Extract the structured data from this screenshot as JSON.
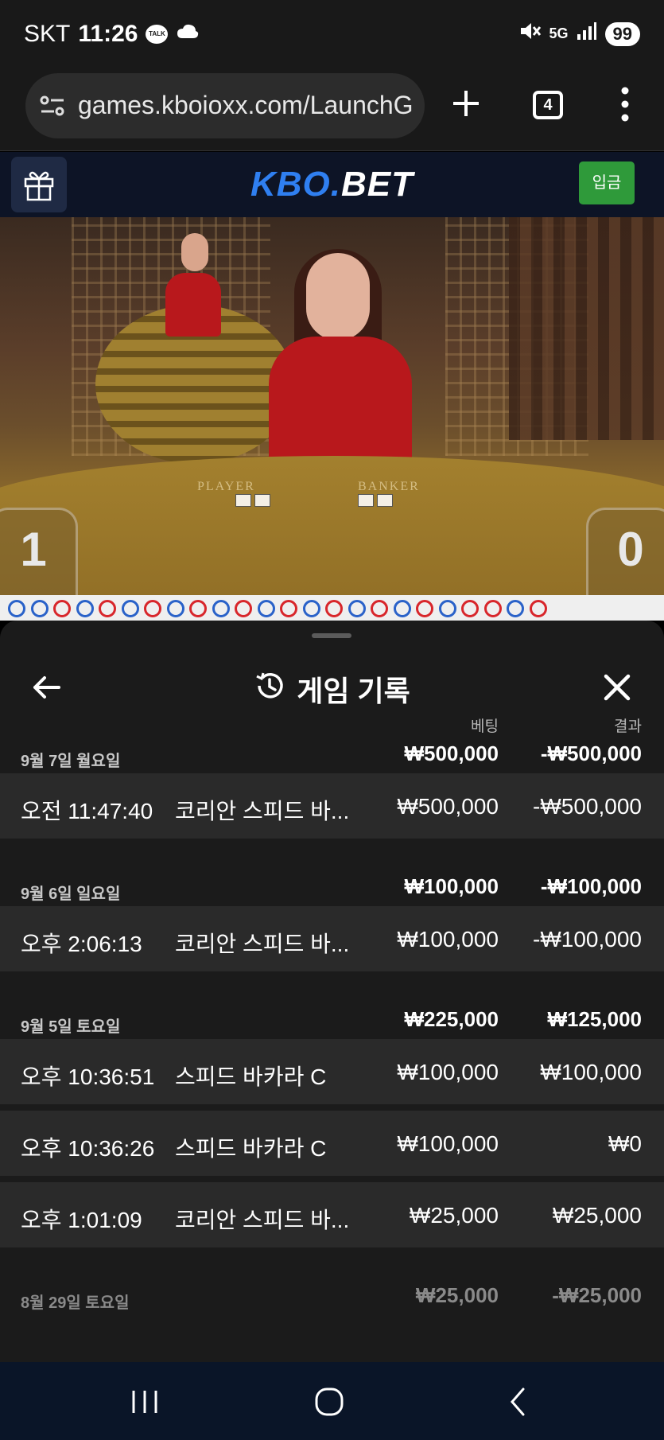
{
  "status_bar": {
    "carrier": "SKT",
    "time": "11:26",
    "notification_icons": [
      "talk-icon",
      "cloud-icon"
    ],
    "talk_label": "TALK",
    "network": "5G",
    "battery": "99"
  },
  "browser": {
    "url": "games.kboioxx.com/LaunchGame",
    "tab_count": "4"
  },
  "site_header": {
    "logo_part1": "KBO.",
    "logo_part2": "BET",
    "deposit_label": "입금",
    "colors": {
      "logo_blue": "#2f7ff0",
      "deposit_green": "#2f9a3a",
      "header_bg": "#0d1426"
    }
  },
  "video": {
    "player_label": "PLAYER",
    "banker_label": "BANKER",
    "player_score": "1",
    "banker_score": "0"
  },
  "sheet": {
    "title": "게임 기록",
    "col_bet": "베팅",
    "col_result": "결과",
    "groups": [
      {
        "date": "9월 7일 월요일",
        "bet_total": "₩500,000",
        "result_total": "-₩500,000",
        "rows": [
          {
            "time": "오전 11:47:40",
            "game": "코리안 스피드 바...",
            "bet": "₩500,000",
            "result": "-₩500,000"
          }
        ]
      },
      {
        "date": "9월 6일 일요일",
        "bet_total": "₩100,000",
        "result_total": "-₩100,000",
        "rows": [
          {
            "time": "오후 2:06:13",
            "game": "코리안 스피드 바...",
            "bet": "₩100,000",
            "result": "-₩100,000"
          }
        ]
      },
      {
        "date": "9월 5일 토요일",
        "bet_total": "₩225,000",
        "result_total": "₩125,000",
        "rows": [
          {
            "time": "오후 10:36:51",
            "game": "스피드 바카라 C",
            "bet": "₩100,000",
            "result": "₩100,000"
          },
          {
            "time": "오후 10:36:26",
            "game": "스피드 바카라 C",
            "bet": "₩100,000",
            "result": "₩0"
          },
          {
            "time": "오후 1:01:09",
            "game": "코리안 스피드 바...",
            "bet": "₩25,000",
            "result": "₩25,000"
          }
        ]
      },
      {
        "date": "8월 29일 토요일",
        "bet_total": "₩25,000",
        "result_total": "-₩25,000",
        "rows": []
      }
    ]
  },
  "nav": {
    "icons": [
      "recent-apps-icon",
      "home-icon",
      "back-icon"
    ]
  }
}
